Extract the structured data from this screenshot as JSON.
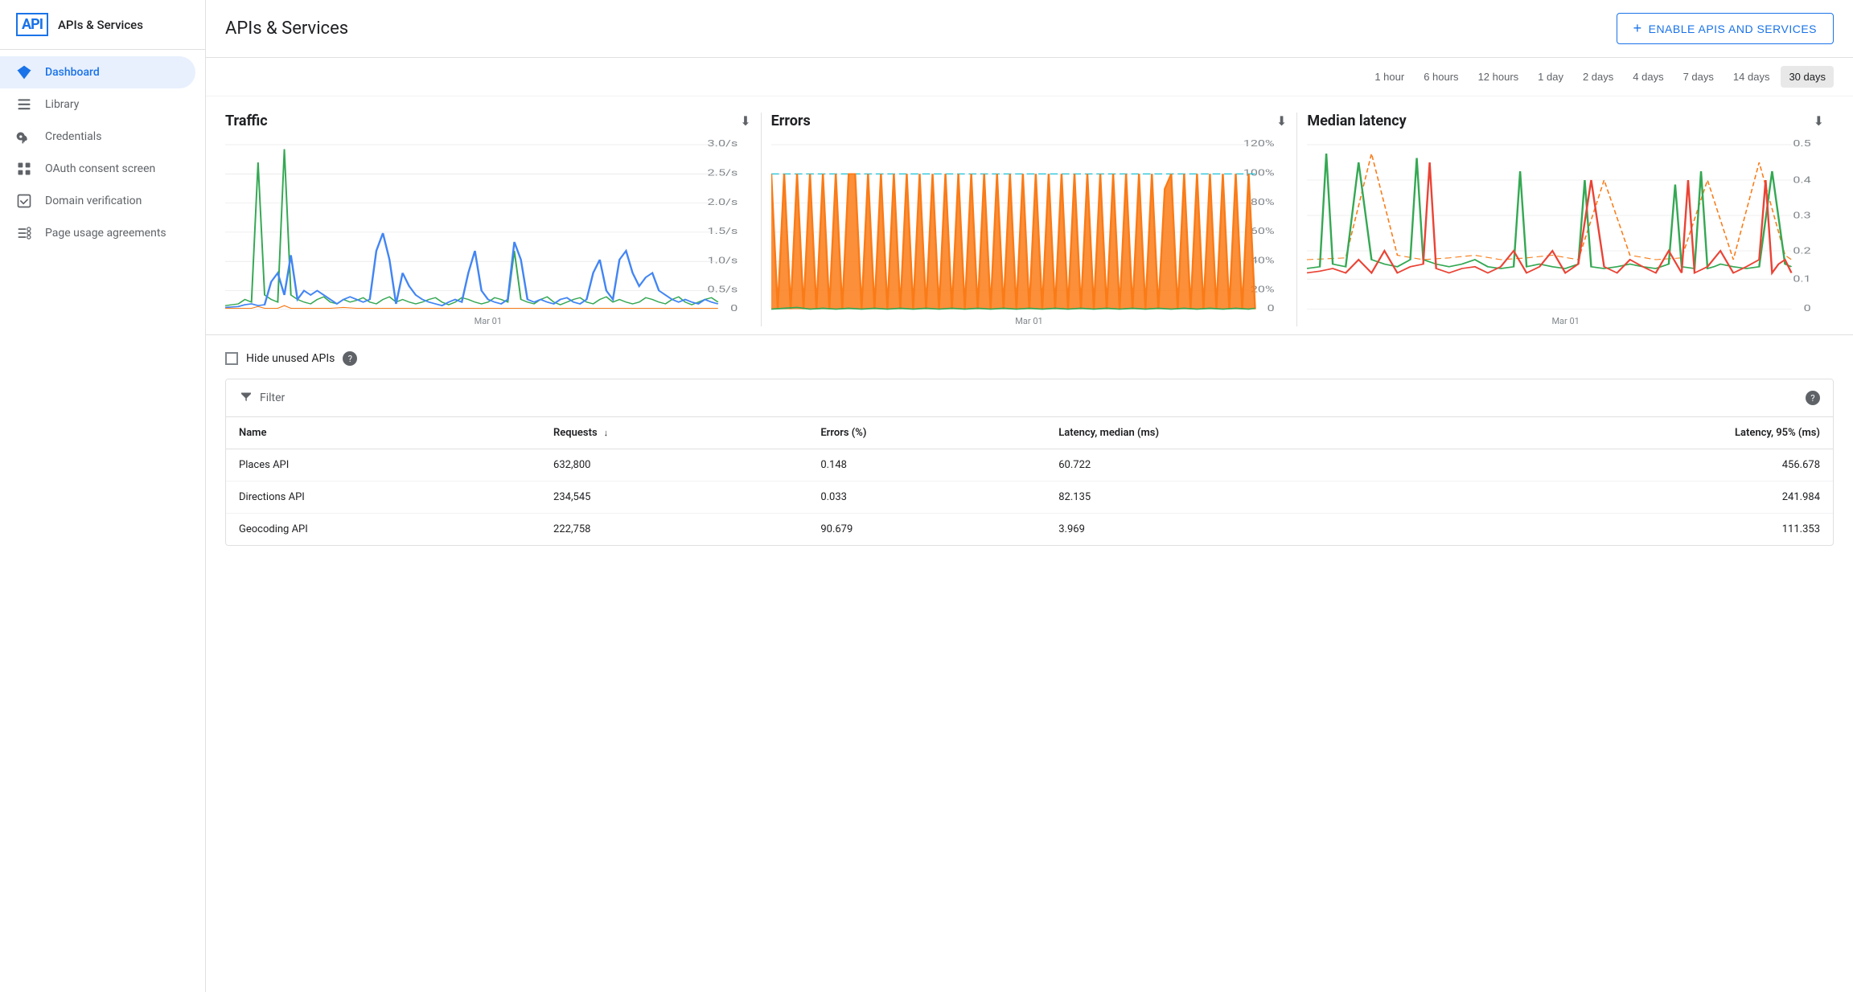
{
  "sidebar": {
    "logo": "API",
    "title": "APIs & Services",
    "items": [
      {
        "id": "dashboard",
        "label": "Dashboard",
        "active": true,
        "icon": "diamond"
      },
      {
        "id": "library",
        "label": "Library",
        "active": false,
        "icon": "bars"
      },
      {
        "id": "credentials",
        "label": "Credentials",
        "active": false,
        "icon": "key"
      },
      {
        "id": "oauth",
        "label": "OAuth consent screen",
        "active": false,
        "icon": "grid"
      },
      {
        "id": "domain",
        "label": "Domain verification",
        "active": false,
        "icon": "checkbox"
      },
      {
        "id": "page-usage",
        "label": "Page usage agreements",
        "active": false,
        "icon": "list-settings"
      }
    ]
  },
  "header": {
    "title": "APIs & Services",
    "enable_btn_label": "ENABLE APIS AND SERVICES"
  },
  "time_range": {
    "options": [
      {
        "id": "1h",
        "label": "1 hour",
        "active": false
      },
      {
        "id": "6h",
        "label": "6 hours",
        "active": false
      },
      {
        "id": "12h",
        "label": "12 hours",
        "active": false
      },
      {
        "id": "1d",
        "label": "1 day",
        "active": false
      },
      {
        "id": "2d",
        "label": "2 days",
        "active": false
      },
      {
        "id": "4d",
        "label": "4 days",
        "active": false
      },
      {
        "id": "7d",
        "label": "7 days",
        "active": false
      },
      {
        "id": "14d",
        "label": "14 days",
        "active": false
      },
      {
        "id": "30d",
        "label": "30 days",
        "active": true
      }
    ]
  },
  "charts": {
    "traffic": {
      "title": "Traffic",
      "x_label": "Mar 01",
      "y_labels": [
        "3.0/s",
        "2.5/s",
        "2.0/s",
        "1.5/s",
        "1.0/s",
        "0.5/s",
        "0"
      ]
    },
    "errors": {
      "title": "Errors",
      "x_label": "Mar 01",
      "y_labels": [
        "120%",
        "100%",
        "80%",
        "60%",
        "40%",
        "20%",
        "0"
      ]
    },
    "latency": {
      "title": "Median latency",
      "x_label": "Mar 01",
      "y_labels": [
        "0.5",
        "0.4",
        "0.3",
        "0.2",
        "0.1",
        "0"
      ]
    }
  },
  "hide_unused": {
    "label": "Hide unused APIs",
    "checked": false
  },
  "filter": {
    "label": "Filter"
  },
  "table": {
    "columns": [
      {
        "id": "name",
        "label": "Name",
        "sortable": false
      },
      {
        "id": "requests",
        "label": "Requests",
        "sortable": true
      },
      {
        "id": "errors",
        "label": "Errors (%)",
        "sortable": false
      },
      {
        "id": "latency_median",
        "label": "Latency, median (ms)",
        "sortable": false
      },
      {
        "id": "latency_95",
        "label": "Latency, 95% (ms)",
        "sortable": false
      }
    ],
    "rows": [
      {
        "name": "Places API",
        "requests": "632,800",
        "errors": "0.148",
        "latency_median": "60.722",
        "latency_95": "456.678"
      },
      {
        "name": "Directions API",
        "requests": "234,545",
        "errors": "0.033",
        "latency_median": "82.135",
        "latency_95": "241.984"
      },
      {
        "name": "Geocoding API",
        "requests": "222,758",
        "errors": "90.679",
        "latency_median": "3.969",
        "latency_95": "111.353"
      }
    ]
  },
  "colors": {
    "primary": "#1a73e8",
    "active_nav_bg": "#e8f0fe",
    "active_nav_text": "#1a73e8",
    "chart_blue": "#4285f4",
    "chart_green": "#34a853",
    "chart_orange": "#fa7b17",
    "chart_red": "#ea4335",
    "chart_teal": "#00bcd4"
  }
}
